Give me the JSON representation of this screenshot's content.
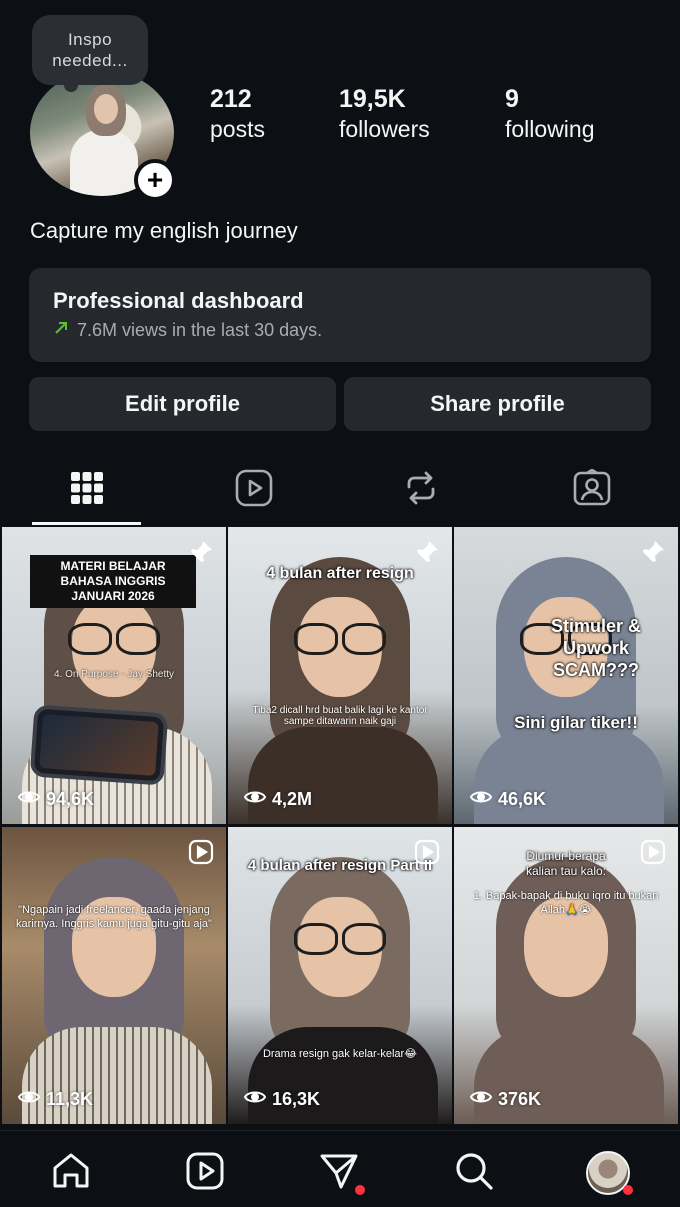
{
  "profile": {
    "note": "Inspo\nneeded...",
    "bio": "Capture my english journey",
    "stats": [
      {
        "value": "212",
        "label": "posts"
      },
      {
        "value": "19,5K",
        "label": "followers"
      },
      {
        "value": "9",
        "label": "following"
      }
    ]
  },
  "dashboard": {
    "title": "Professional dashboard",
    "subtitle": "7.6M views in the last 30 days."
  },
  "actions": {
    "edit_label": "Edit profile",
    "share_label": "Share profile"
  },
  "tabs": [
    {
      "icon": "grid-icon",
      "active": true
    },
    {
      "icon": "reels-icon",
      "active": false
    },
    {
      "icon": "reposts-icon",
      "active": false
    },
    {
      "icon": "tagged-icon",
      "active": false
    }
  ],
  "posts": [
    {
      "views": "94,6K",
      "pinned": true,
      "caption": "MATERI BELAJAR BAHASA INGGRIS JANUARI 2026",
      "subcaption": "4. On Purpose - Jay Shetty"
    },
    {
      "views": "4,2M",
      "pinned": true,
      "caption": "4 bulan after resign",
      "subcaption": "Tiba2 dicall hrd buat balik lagi ke kantor sampe ditawarin naik gaji"
    },
    {
      "views": "46,6K",
      "pinned": true,
      "caption": "Stimuler & Upwork SCAM???",
      "subcaption": "Sini gilar tiker!!"
    },
    {
      "views": "11,3K",
      "pinned": false,
      "caption": "",
      "subcaption": "\"Ngapain jadi freelancer, gaada jenjang karirnya. Inggris kamu juga gitu-gitu aja\""
    },
    {
      "views": "16,3K",
      "pinned": false,
      "caption": "4 bulan after resign Part II",
      "subcaption": "Drama resign gak kelar-kelar😂"
    },
    {
      "views": "376K",
      "pinned": false,
      "caption": "Diumur berapa kalian tau kalo:",
      "subcaption": "1. Bapak-bapak di buku iqro itu bukan Allah🙏😭"
    }
  ],
  "bottom_nav": [
    {
      "icon": "home-icon",
      "badge": false
    },
    {
      "icon": "reels-icon",
      "badge": false
    },
    {
      "icon": "messages-icon",
      "badge": true
    },
    {
      "icon": "search-icon",
      "badge": false
    },
    {
      "icon": "profile-avatar",
      "badge": true
    }
  ],
  "colors": {
    "background": "#0c1014",
    "card": "#25292e",
    "trend_green": "#58c322",
    "badge_red": "#ff3040"
  }
}
